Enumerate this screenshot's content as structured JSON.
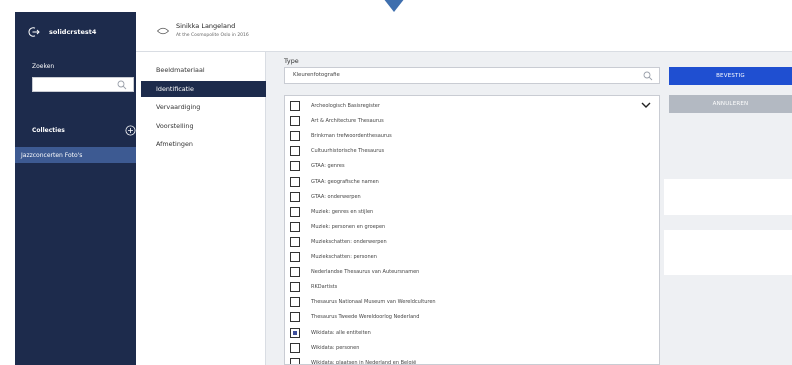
{
  "sidebar": {
    "username": "solidcrstest4",
    "search_label": "Zoeken",
    "collections_label": "Collecties",
    "collection_item": "Jazzconcerten Foto's"
  },
  "header": {
    "name": "Sinikka Langeland",
    "subtitle": "At the Cosmopolite Oslo in 2016"
  },
  "tabs": [
    {
      "label": "Beeldmateriaal",
      "active": false
    },
    {
      "label": "Identificatie",
      "active": true
    },
    {
      "label": "Vervaardiging",
      "active": false
    },
    {
      "label": "Voorstelling",
      "active": false
    },
    {
      "label": "Afmetingen",
      "active": false
    }
  ],
  "field": {
    "label": "Type",
    "value": "Kleurenfotografie"
  },
  "buttons": {
    "confirm": "BEVESTIG",
    "cancel": "ANNULEREN"
  },
  "options": [
    {
      "label": "Archeologisch Basisregister",
      "checked": false
    },
    {
      "label": "Art & Architecture Thesaurus",
      "checked": false
    },
    {
      "label": "Brinkman trefwoordenthesaurus",
      "checked": false
    },
    {
      "label": "Cultuurhistorische Thesaurus",
      "checked": false
    },
    {
      "label": "GTAA: genres",
      "checked": false
    },
    {
      "label": "GTAA: geografische namen",
      "checked": false
    },
    {
      "label": "GTAA: onderwerpen",
      "checked": false
    },
    {
      "label": "Muziek: genres en stijlen",
      "checked": false
    },
    {
      "label": "Muziek: personen en groepen",
      "checked": false
    },
    {
      "label": "Muziekschatten: onderwerpen",
      "checked": false
    },
    {
      "label": "Muziekschatten: personen",
      "checked": false
    },
    {
      "label": "Nederlandse Thesaurus van Auteursnamen",
      "checked": false
    },
    {
      "label": "RKDartists",
      "checked": false
    },
    {
      "label": "Thesaurus Nationaal Museum van Wereldculturen",
      "checked": false
    },
    {
      "label": "Thesaurus Tweede Wereldoorlog Nederland",
      "checked": false
    },
    {
      "label": "Wikidata: alle entiteiten",
      "checked": true
    },
    {
      "label": "Wikidata: personen",
      "checked": false
    },
    {
      "label": "Wikidata: plaatsen in Nederland en België",
      "checked": false
    }
  ]
}
